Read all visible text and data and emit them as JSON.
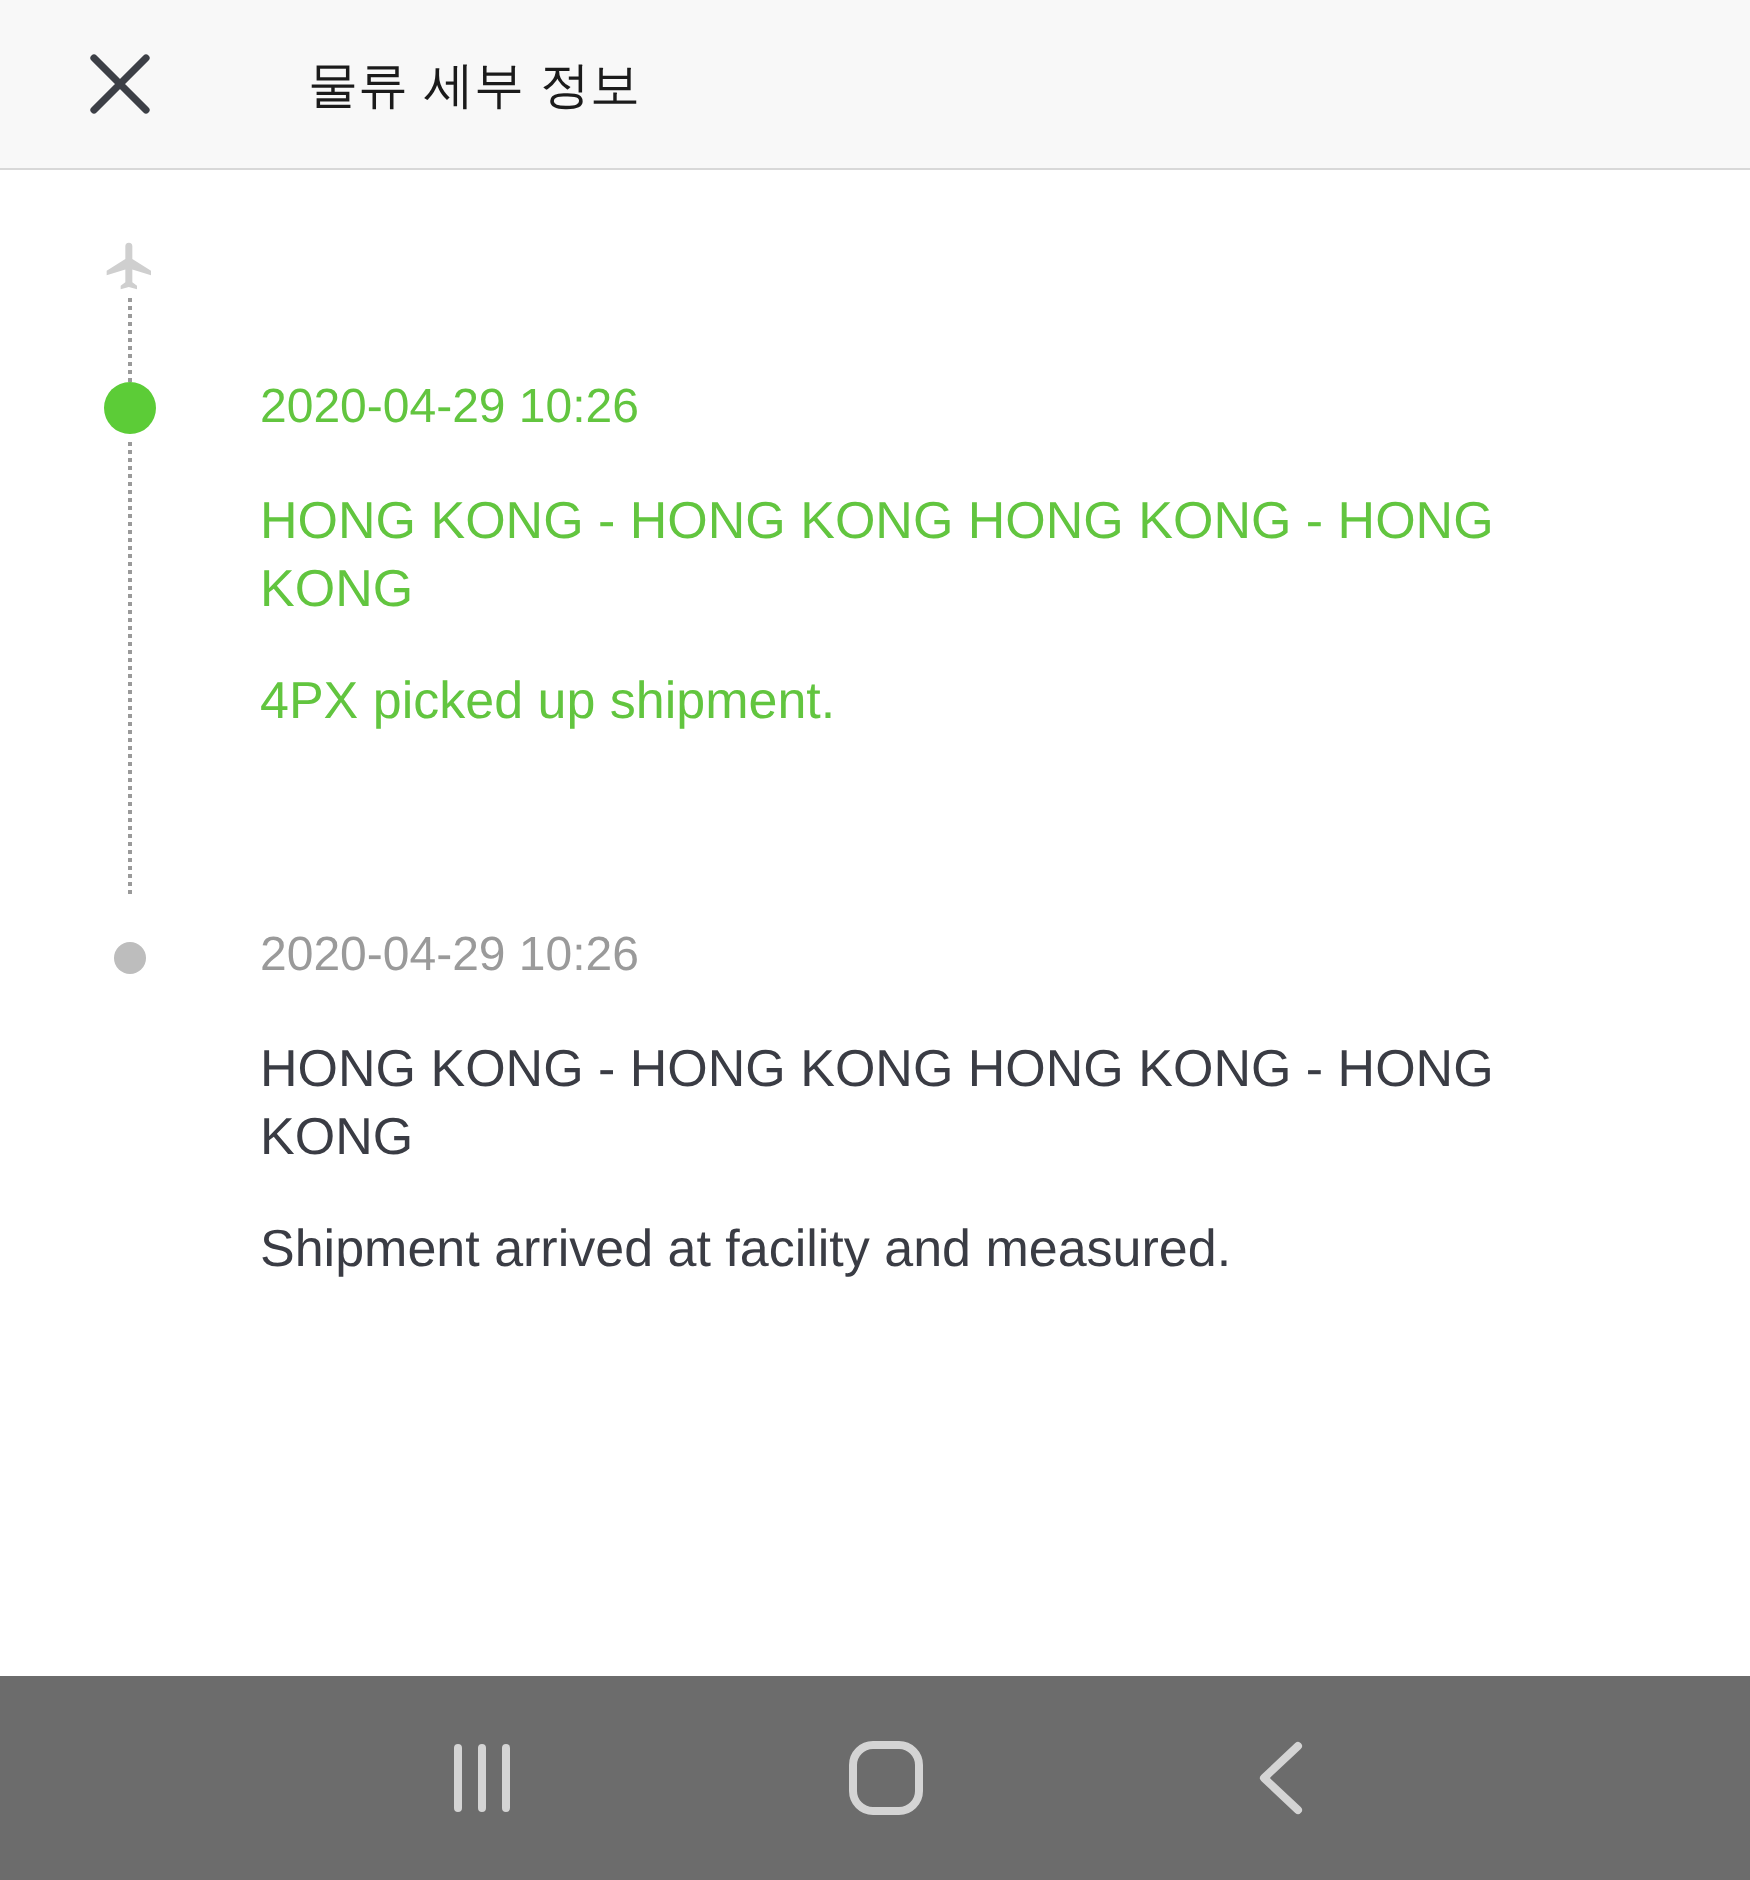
{
  "header": {
    "title": "물류 세부 정보"
  },
  "events": [
    {
      "date": "2020-04-29 10:26",
      "location": "HONG KONG - HONG KONG HONG KONG - HONG KONG",
      "message": "4PX picked up shipment.",
      "current": true
    },
    {
      "date": "2020-04-29 10:26",
      "location": "HONG KONG - HONG KONG HONG KONG - HONG KONG",
      "message": "Shipment arrived at facility and measured.",
      "current": false
    }
  ]
}
